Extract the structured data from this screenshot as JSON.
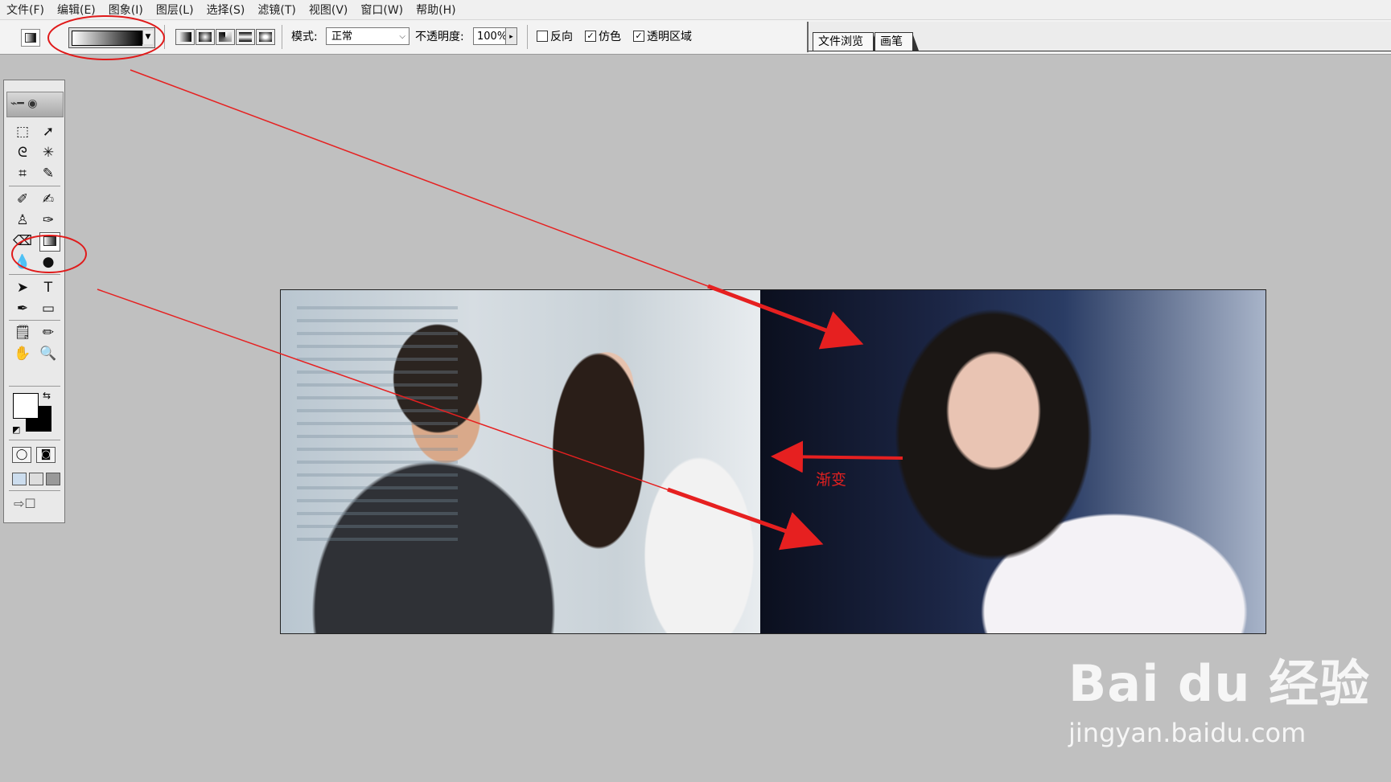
{
  "menu": [
    "文件(F)",
    "编辑(E)",
    "图象(I)",
    "图层(L)",
    "选择(S)",
    "滤镜(T)",
    "视图(V)",
    "窗口(W)",
    "帮助(H)"
  ],
  "options": {
    "mode_label": "模式:",
    "mode_value": "正常",
    "opacity_label": "不透明度:",
    "opacity_value": "100%",
    "reverse_label": "反向",
    "dither_label": "仿色",
    "transparency_label": "透明区域",
    "reverse_checked": false,
    "dither_checked": true,
    "transparency_checked": true
  },
  "palette_tabs": [
    "文件浏览",
    "画笔"
  ],
  "annotation": {
    "label": "渐变",
    "color": "#e02020"
  },
  "watermark": {
    "main": "Bai du 经验",
    "sub": "jingyan.baidu.com"
  },
  "tools": {
    "marquee": "marquee-icon",
    "move": "move-icon",
    "lasso": "lasso-icon",
    "magic_wand": "magic-wand-icon",
    "crop": "crop-icon",
    "slice": "slice-icon",
    "healing": "healing-brush-icon",
    "brush": "brush-icon",
    "stamp": "clone-stamp-icon",
    "history_brush": "history-brush-icon",
    "eraser": "eraser-icon",
    "gradient": "gradient-icon",
    "blur": "blur-icon",
    "dodge": "dodge-icon",
    "path_select": "path-select-icon",
    "type": "type-icon",
    "pen": "pen-icon",
    "shape": "shape-icon",
    "notes": "notes-icon",
    "eyedropper": "eyedropper-icon",
    "hand": "hand-icon",
    "zoom": "zoom-icon"
  }
}
